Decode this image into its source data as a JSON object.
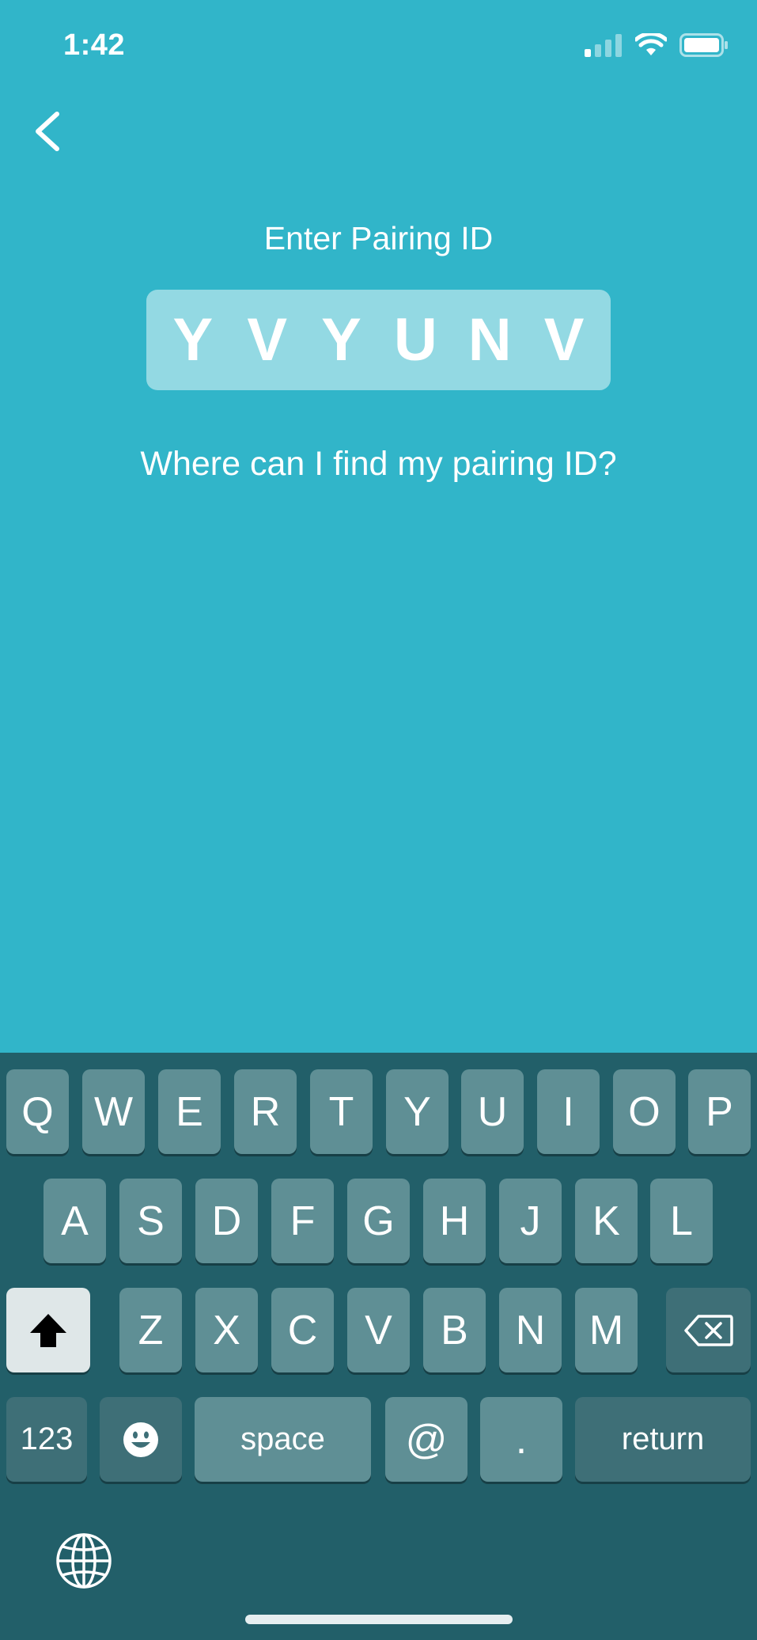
{
  "status": {
    "time": "1:42"
  },
  "screen": {
    "title": "Enter Pairing ID",
    "pairing_chars": [
      "Y",
      "V",
      "Y",
      "U",
      "N",
      "V"
    ],
    "help_link": "Where can I find my pairing ID?"
  },
  "keyboard": {
    "row1": [
      "Q",
      "W",
      "E",
      "R",
      "T",
      "Y",
      "U",
      "I",
      "O",
      "P"
    ],
    "row2": [
      "A",
      "S",
      "D",
      "F",
      "G",
      "H",
      "J",
      "K",
      "L"
    ],
    "row3": [
      "Z",
      "X",
      "C",
      "V",
      "B",
      "N",
      "M"
    ],
    "bottom": {
      "numbers": "123",
      "space": "space",
      "at": "@",
      "period": ".",
      "return": "return"
    }
  },
  "colors": {
    "background": "#31b5c9",
    "pairing_box": "#93d9e3",
    "keyboard_bg": "#225f69",
    "key": "#5f8f95"
  },
  "icons": [
    "back-chevron-icon",
    "cellular-signal-icon",
    "wifi-icon",
    "battery-icon",
    "shift-icon",
    "delete-icon",
    "emoji-icon",
    "globe-icon"
  ]
}
